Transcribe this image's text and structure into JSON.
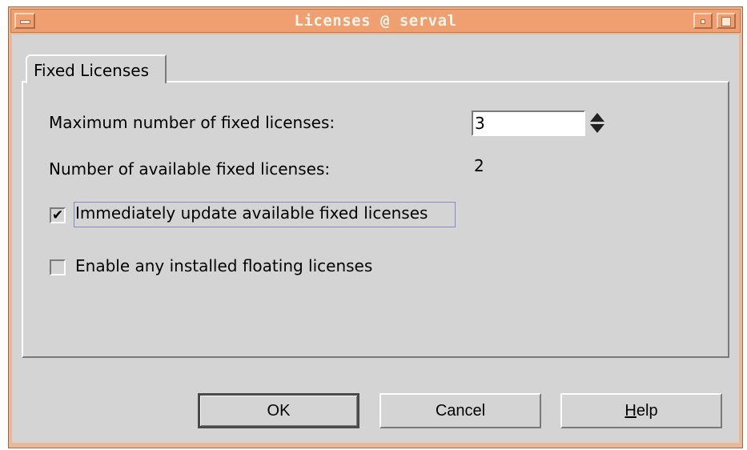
{
  "window": {
    "title": "Licenses @ serval"
  },
  "tabs": [
    {
      "label": "Fixed Licenses"
    }
  ],
  "fields": {
    "max_fixed_label": "Maximum number of fixed licenses:",
    "max_fixed_value": "3",
    "available_fixed_label": "Number of available fixed licenses:",
    "available_fixed_value": "2"
  },
  "checkboxes": [
    {
      "label": "Immediately update available fixed licenses",
      "checked": true,
      "mark": "✔"
    },
    {
      "label": "Enable any installed floating licenses",
      "checked": false,
      "mark": ""
    }
  ],
  "buttons": {
    "ok": "OK",
    "cancel": "Cancel",
    "help": "Help"
  }
}
